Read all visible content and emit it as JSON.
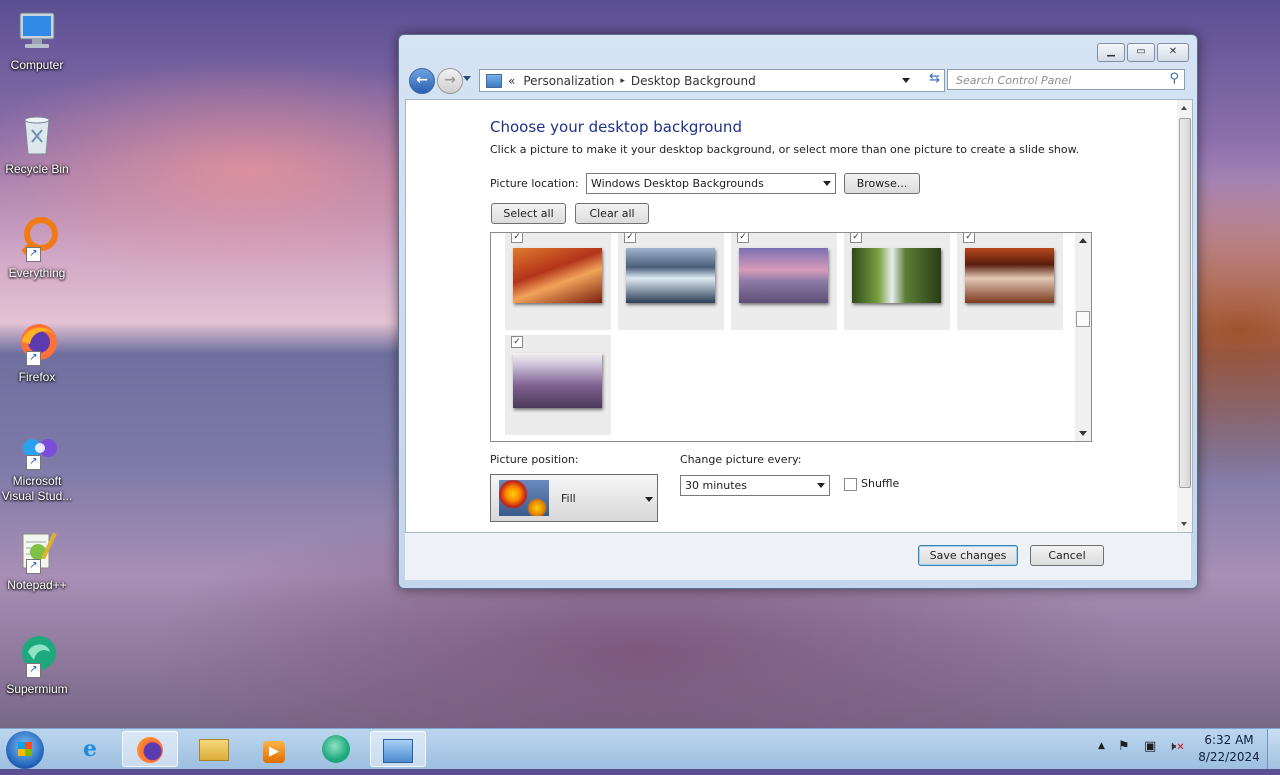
{
  "desktop": {
    "icons": [
      {
        "label": "Computer"
      },
      {
        "label": "Recycle Bin"
      },
      {
        "label": "Everything"
      },
      {
        "label": "Firefox"
      },
      {
        "label": "Microsoft Visual Stud..."
      },
      {
        "label": "Notepad++"
      },
      {
        "label": "Supermium"
      }
    ]
  },
  "window": {
    "breadcrumb": {
      "prefix": "«",
      "item1": "Personalization",
      "separator": "▸",
      "item2": "Desktop Background"
    },
    "search_placeholder": "Search Control Panel",
    "heading": "Choose your desktop background",
    "description": "Click a picture to make it your desktop background, or select more than one picture to create a slide show.",
    "picture_location_label": "Picture location:",
    "picture_location_value": "Windows Desktop Backgrounds",
    "browse_label": "Browse...",
    "select_all_label": "Select all",
    "clear_all_label": "Clear all",
    "thumbnails": [
      {
        "name": "red rock canyon",
        "checked": true
      },
      {
        "name": "lake with ice and mountains",
        "checked": true
      },
      {
        "name": "rocky coast at dusk",
        "checked": true
      },
      {
        "name": "waterfall in green forest",
        "checked": true
      },
      {
        "name": "rock arch",
        "checked": true
      },
      {
        "name": "lavender field",
        "checked": true
      }
    ],
    "picture_position_label": "Picture position:",
    "picture_position_value": "Fill",
    "change_picture_label": "Change picture every:",
    "change_picture_value": "30 minutes",
    "shuffle_label": "Shuffle",
    "shuffle_checked": false,
    "save_label": "Save changes",
    "cancel_label": "Cancel"
  },
  "taskbar": {
    "time": "6:32 AM",
    "date": "8/22/2024"
  }
}
